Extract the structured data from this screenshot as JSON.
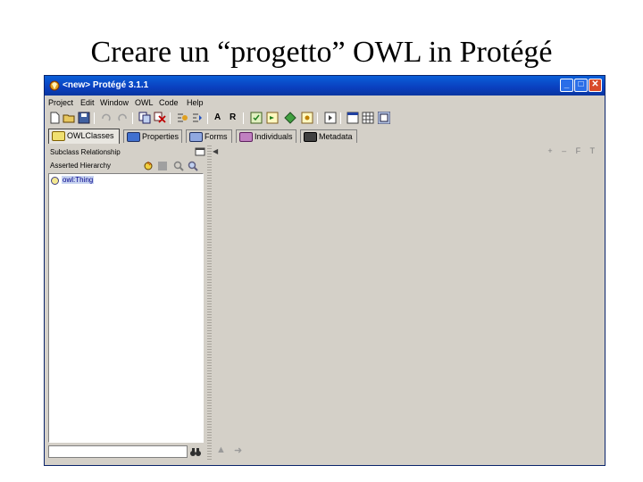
{
  "slide": {
    "title": "Creare un “progetto” OWL in Protégé"
  },
  "window": {
    "title": "<new>  Protégé 3.1.1",
    "controls": {
      "minimize": "_",
      "maximize": "□",
      "close": "✕"
    }
  },
  "menu": {
    "items": [
      "Project",
      "Edit",
      "Window",
      "OWL",
      "Code",
      "Help"
    ]
  },
  "toolbar": {
    "text_a": "A",
    "text_r": "R"
  },
  "tabs": [
    {
      "label": "OWLClasses",
      "active": true
    },
    {
      "label": "Properties",
      "active": false
    },
    {
      "label": "Forms",
      "active": false
    },
    {
      "label": "Individuals",
      "active": false
    },
    {
      "label": "Metadata",
      "active": false
    }
  ],
  "left_panel": {
    "header": "Subclass Relationship",
    "subheader": "Asserted Hierarchy",
    "tree": [
      {
        "label": "owl:Thing"
      }
    ]
  },
  "right_panel": {
    "actions": "+ – F T"
  },
  "colors": {
    "title_bar": "#0a3fbf",
    "window_bg": "#d4d0c8",
    "selection": "#c8d4f0"
  }
}
